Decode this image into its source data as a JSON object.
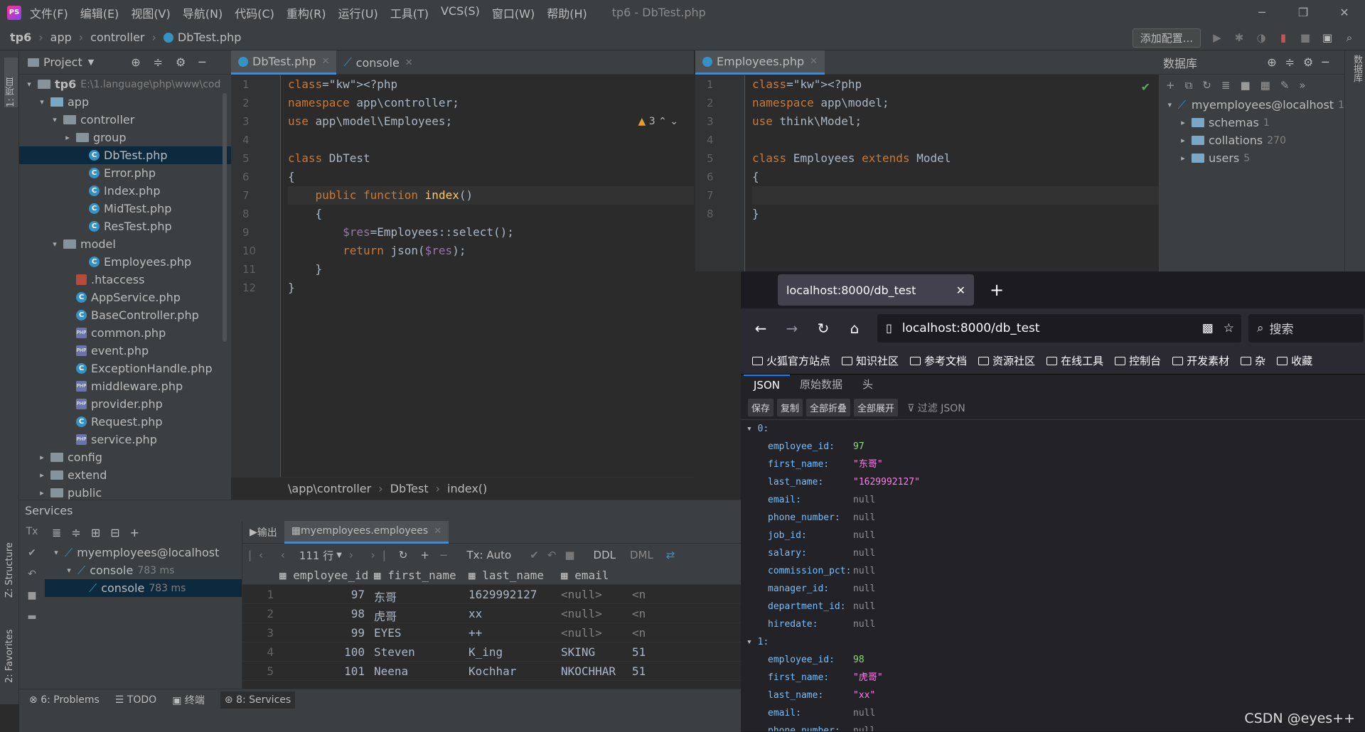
{
  "ide": {
    "menu": [
      "文件(F)",
      "编辑(E)",
      "视图(V)",
      "导航(N)",
      "代码(C)",
      "重构(R)",
      "运行(U)",
      "工具(T)",
      "VCS(S)",
      "窗口(W)",
      "帮助(H)"
    ],
    "window_title": "tp6 - DbTest.php",
    "breadcrumb": [
      "tp6",
      "app",
      "controller",
      "DbTest.php"
    ],
    "add_config": "添加配置...",
    "left_strip": {
      "project": "1: 项目",
      "structure": "Z: Structure",
      "favorites": "2: Favorites"
    },
    "project": {
      "title": "Project",
      "rows": [
        {
          "label": "tp6",
          "extra": "E:\\1.language\\php\\www\\cod",
          "kind": "folder",
          "indent": 0,
          "arrow": "▾"
        },
        {
          "label": "app",
          "kind": "folder-blue",
          "indent": 1,
          "arrow": "▾"
        },
        {
          "label": "controller",
          "kind": "folder",
          "indent": 2,
          "arrow": "▾"
        },
        {
          "label": "group",
          "kind": "folder",
          "indent": 3,
          "arrow": "▸"
        },
        {
          "label": "DbTest.php",
          "kind": "class",
          "indent": 4,
          "arrow": "",
          "selected": true
        },
        {
          "label": "Error.php",
          "kind": "class",
          "indent": 4,
          "arrow": ""
        },
        {
          "label": "Index.php",
          "kind": "class",
          "indent": 4,
          "arrow": ""
        },
        {
          "label": "MidTest.php",
          "kind": "class",
          "indent": 4,
          "arrow": ""
        },
        {
          "label": "ResTest.php",
          "kind": "class",
          "indent": 4,
          "arrow": ""
        },
        {
          "label": "model",
          "kind": "folder",
          "indent": 2,
          "arrow": "▾"
        },
        {
          "label": "Employees.php",
          "kind": "class",
          "indent": 4,
          "arrow": ""
        },
        {
          "label": ".htaccess",
          "kind": "htaccess",
          "indent": 3,
          "arrow": ""
        },
        {
          "label": "AppService.php",
          "kind": "class",
          "indent": 3,
          "arrow": ""
        },
        {
          "label": "BaseController.php",
          "kind": "class",
          "indent": 3,
          "arrow": ""
        },
        {
          "label": "common.php",
          "kind": "php",
          "indent": 3,
          "arrow": ""
        },
        {
          "label": "event.php",
          "kind": "php",
          "indent": 3,
          "arrow": ""
        },
        {
          "label": "ExceptionHandle.php",
          "kind": "class",
          "indent": 3,
          "arrow": ""
        },
        {
          "label": "middleware.php",
          "kind": "php",
          "indent": 3,
          "arrow": ""
        },
        {
          "label": "provider.php",
          "kind": "php",
          "indent": 3,
          "arrow": ""
        },
        {
          "label": "Request.php",
          "kind": "class",
          "indent": 3,
          "arrow": ""
        },
        {
          "label": "service.php",
          "kind": "php",
          "indent": 3,
          "arrow": ""
        },
        {
          "label": "config",
          "kind": "folder",
          "indent": 1,
          "arrow": "▸"
        },
        {
          "label": "extend",
          "kind": "folder",
          "indent": 1,
          "arrow": "▸"
        },
        {
          "label": "public",
          "kind": "folder",
          "indent": 1,
          "arrow": "▸"
        }
      ]
    },
    "editor1": {
      "tabs": [
        {
          "label": "DbTest.php",
          "active": true
        },
        {
          "label": "console",
          "active": false
        }
      ],
      "warning_count": "3",
      "lines": [
        "<?php",
        "namespace app\\controller;",
        "use app\\model\\Employees;",
        "",
        "class DbTest",
        "{",
        "    public function index()",
        "    {",
        "        $res=Employees::select();",
        "        return json($res);",
        "    }",
        "}"
      ],
      "breadcrumb": [
        "\\app\\controller",
        "DbTest",
        "index()"
      ]
    },
    "editor2": {
      "tabs": [
        {
          "label": "Employees.php",
          "active": true
        }
      ],
      "lines": [
        "<?php",
        "namespace app\\model;",
        "use think\\Model;",
        "",
        "class Employees extends Model",
        "{",
        "",
        "}"
      ]
    },
    "database": {
      "title": "数据库",
      "root": "myemployees@localhost",
      "root_badge": "1",
      "children": [
        {
          "label": "schemas",
          "count": "1"
        },
        {
          "label": "collations",
          "count": "270"
        },
        {
          "label": "users",
          "count": "5"
        }
      ],
      "right_strip": "数据库"
    },
    "services": {
      "title": "Services",
      "tree": [
        {
          "label": "myemployees@localhost",
          "time": ""
        },
        {
          "label": "console",
          "time": "783 ms"
        },
        {
          "label": "console",
          "time": "783 ms"
        }
      ],
      "tabs": [
        {
          "label": "输出"
        },
        {
          "label": "myemployees.employees"
        }
      ],
      "grid_toolbar": {
        "rows": "111 行",
        "tx": "Tx: Auto",
        "ddl": "DDL",
        "dml": "DML"
      },
      "columns": [
        "employee_id",
        "first_name",
        "last_name",
        "email"
      ],
      "rows": [
        {
          "n": "1",
          "id": "97",
          "first": "东哥",
          "last": "1629992127",
          "email": "<null>",
          "more": "<n"
        },
        {
          "n": "2",
          "id": "98",
          "first": "虎哥",
          "last": "xx",
          "email": "<null>",
          "more": "<n"
        },
        {
          "n": "3",
          "id": "99",
          "first": "EYES",
          "last": "++",
          "email": "<null>",
          "more": "<n"
        },
        {
          "n": "4",
          "id": "100",
          "first": "Steven",
          "last": "K_ing",
          "email": "SKING",
          "more": "51"
        },
        {
          "n": "5",
          "id": "101",
          "first": "Neena",
          "last": "Kochhar",
          "email": "NKOCHHAR",
          "more": "51"
        }
      ]
    },
    "status": [
      {
        "label": "6: Problems"
      },
      {
        "label": "TODO"
      },
      {
        "label": "终端"
      },
      {
        "label": "8: Services"
      }
    ]
  },
  "browser": {
    "tab_title": "localhost:8000/db_test",
    "url": "localhost:8000/db_test",
    "search_placeholder": "搜索",
    "bookmarks": [
      "火狐官方站点",
      "知识社区",
      "参考文档",
      "资源社区",
      "在线工具",
      "控制台",
      "开发素材",
      "杂",
      "收藏"
    ],
    "json_tabs": [
      "JSON",
      "原始数据",
      "头"
    ],
    "json_buttons": [
      "保存",
      "复制",
      "全部折叠",
      "全部展开"
    ],
    "filter": "过滤 JSON",
    "records": [
      {
        "index": "0:",
        "fields": [
          {
            "k": "employee_id:",
            "v": "97",
            "t": "num"
          },
          {
            "k": "first_name:",
            "v": "\"东哥\"",
            "t": "str"
          },
          {
            "k": "last_name:",
            "v": "\"1629992127\"",
            "t": "str"
          },
          {
            "k": "email:",
            "v": "null",
            "t": "null"
          },
          {
            "k": "phone_number:",
            "v": "null",
            "t": "null"
          },
          {
            "k": "job_id:",
            "v": "null",
            "t": "null"
          },
          {
            "k": "salary:",
            "v": "null",
            "t": "null"
          },
          {
            "k": "commission_pct:",
            "v": "null",
            "t": "null"
          },
          {
            "k": "manager_id:",
            "v": "null",
            "t": "null"
          },
          {
            "k": "department_id:",
            "v": "null",
            "t": "null"
          },
          {
            "k": "hiredate:",
            "v": "null",
            "t": "null"
          }
        ]
      },
      {
        "index": "1:",
        "fields": [
          {
            "k": "employee_id:",
            "v": "98",
            "t": "num"
          },
          {
            "k": "first_name:",
            "v": "\"虎哥\"",
            "t": "str"
          },
          {
            "k": "last_name:",
            "v": "\"xx\"",
            "t": "str"
          },
          {
            "k": "email:",
            "v": "null",
            "t": "null"
          },
          {
            "k": "phone_number:",
            "v": "null",
            "t": "null"
          }
        ]
      }
    ]
  },
  "watermark": "CSDN @eyes++"
}
